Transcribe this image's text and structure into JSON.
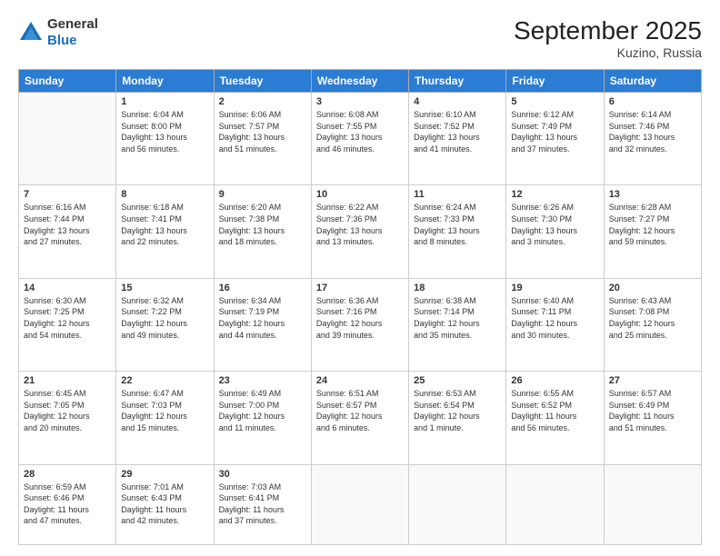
{
  "header": {
    "logo_general": "General",
    "logo_blue": "Blue",
    "month": "September 2025",
    "location": "Kuzino, Russia"
  },
  "days_header": [
    "Sunday",
    "Monday",
    "Tuesday",
    "Wednesday",
    "Thursday",
    "Friday",
    "Saturday"
  ],
  "weeks": [
    [
      {
        "num": "",
        "info": ""
      },
      {
        "num": "1",
        "info": "Sunrise: 6:04 AM\nSunset: 8:00 PM\nDaylight: 13 hours\nand 56 minutes."
      },
      {
        "num": "2",
        "info": "Sunrise: 6:06 AM\nSunset: 7:57 PM\nDaylight: 13 hours\nand 51 minutes."
      },
      {
        "num": "3",
        "info": "Sunrise: 6:08 AM\nSunset: 7:55 PM\nDaylight: 13 hours\nand 46 minutes."
      },
      {
        "num": "4",
        "info": "Sunrise: 6:10 AM\nSunset: 7:52 PM\nDaylight: 13 hours\nand 41 minutes."
      },
      {
        "num": "5",
        "info": "Sunrise: 6:12 AM\nSunset: 7:49 PM\nDaylight: 13 hours\nand 37 minutes."
      },
      {
        "num": "6",
        "info": "Sunrise: 6:14 AM\nSunset: 7:46 PM\nDaylight: 13 hours\nand 32 minutes."
      }
    ],
    [
      {
        "num": "7",
        "info": "Sunrise: 6:16 AM\nSunset: 7:44 PM\nDaylight: 13 hours\nand 27 minutes."
      },
      {
        "num": "8",
        "info": "Sunrise: 6:18 AM\nSunset: 7:41 PM\nDaylight: 13 hours\nand 22 minutes."
      },
      {
        "num": "9",
        "info": "Sunrise: 6:20 AM\nSunset: 7:38 PM\nDaylight: 13 hours\nand 18 minutes."
      },
      {
        "num": "10",
        "info": "Sunrise: 6:22 AM\nSunset: 7:36 PM\nDaylight: 13 hours\nand 13 minutes."
      },
      {
        "num": "11",
        "info": "Sunrise: 6:24 AM\nSunset: 7:33 PM\nDaylight: 13 hours\nand 8 minutes."
      },
      {
        "num": "12",
        "info": "Sunrise: 6:26 AM\nSunset: 7:30 PM\nDaylight: 13 hours\nand 3 minutes."
      },
      {
        "num": "13",
        "info": "Sunrise: 6:28 AM\nSunset: 7:27 PM\nDaylight: 12 hours\nand 59 minutes."
      }
    ],
    [
      {
        "num": "14",
        "info": "Sunrise: 6:30 AM\nSunset: 7:25 PM\nDaylight: 12 hours\nand 54 minutes."
      },
      {
        "num": "15",
        "info": "Sunrise: 6:32 AM\nSunset: 7:22 PM\nDaylight: 12 hours\nand 49 minutes."
      },
      {
        "num": "16",
        "info": "Sunrise: 6:34 AM\nSunset: 7:19 PM\nDaylight: 12 hours\nand 44 minutes."
      },
      {
        "num": "17",
        "info": "Sunrise: 6:36 AM\nSunset: 7:16 PM\nDaylight: 12 hours\nand 39 minutes."
      },
      {
        "num": "18",
        "info": "Sunrise: 6:38 AM\nSunset: 7:14 PM\nDaylight: 12 hours\nand 35 minutes."
      },
      {
        "num": "19",
        "info": "Sunrise: 6:40 AM\nSunset: 7:11 PM\nDaylight: 12 hours\nand 30 minutes."
      },
      {
        "num": "20",
        "info": "Sunrise: 6:43 AM\nSunset: 7:08 PM\nDaylight: 12 hours\nand 25 minutes."
      }
    ],
    [
      {
        "num": "21",
        "info": "Sunrise: 6:45 AM\nSunset: 7:05 PM\nDaylight: 12 hours\nand 20 minutes."
      },
      {
        "num": "22",
        "info": "Sunrise: 6:47 AM\nSunset: 7:03 PM\nDaylight: 12 hours\nand 15 minutes."
      },
      {
        "num": "23",
        "info": "Sunrise: 6:49 AM\nSunset: 7:00 PM\nDaylight: 12 hours\nand 11 minutes."
      },
      {
        "num": "24",
        "info": "Sunrise: 6:51 AM\nSunset: 6:57 PM\nDaylight: 12 hours\nand 6 minutes."
      },
      {
        "num": "25",
        "info": "Sunrise: 6:53 AM\nSunset: 6:54 PM\nDaylight: 12 hours\nand 1 minute."
      },
      {
        "num": "26",
        "info": "Sunrise: 6:55 AM\nSunset: 6:52 PM\nDaylight: 11 hours\nand 56 minutes."
      },
      {
        "num": "27",
        "info": "Sunrise: 6:57 AM\nSunset: 6:49 PM\nDaylight: 11 hours\nand 51 minutes."
      }
    ],
    [
      {
        "num": "28",
        "info": "Sunrise: 6:59 AM\nSunset: 6:46 PM\nDaylight: 11 hours\nand 47 minutes."
      },
      {
        "num": "29",
        "info": "Sunrise: 7:01 AM\nSunset: 6:43 PM\nDaylight: 11 hours\nand 42 minutes."
      },
      {
        "num": "30",
        "info": "Sunrise: 7:03 AM\nSunset: 6:41 PM\nDaylight: 11 hours\nand 37 minutes."
      },
      {
        "num": "",
        "info": ""
      },
      {
        "num": "",
        "info": ""
      },
      {
        "num": "",
        "info": ""
      },
      {
        "num": "",
        "info": ""
      }
    ]
  ]
}
